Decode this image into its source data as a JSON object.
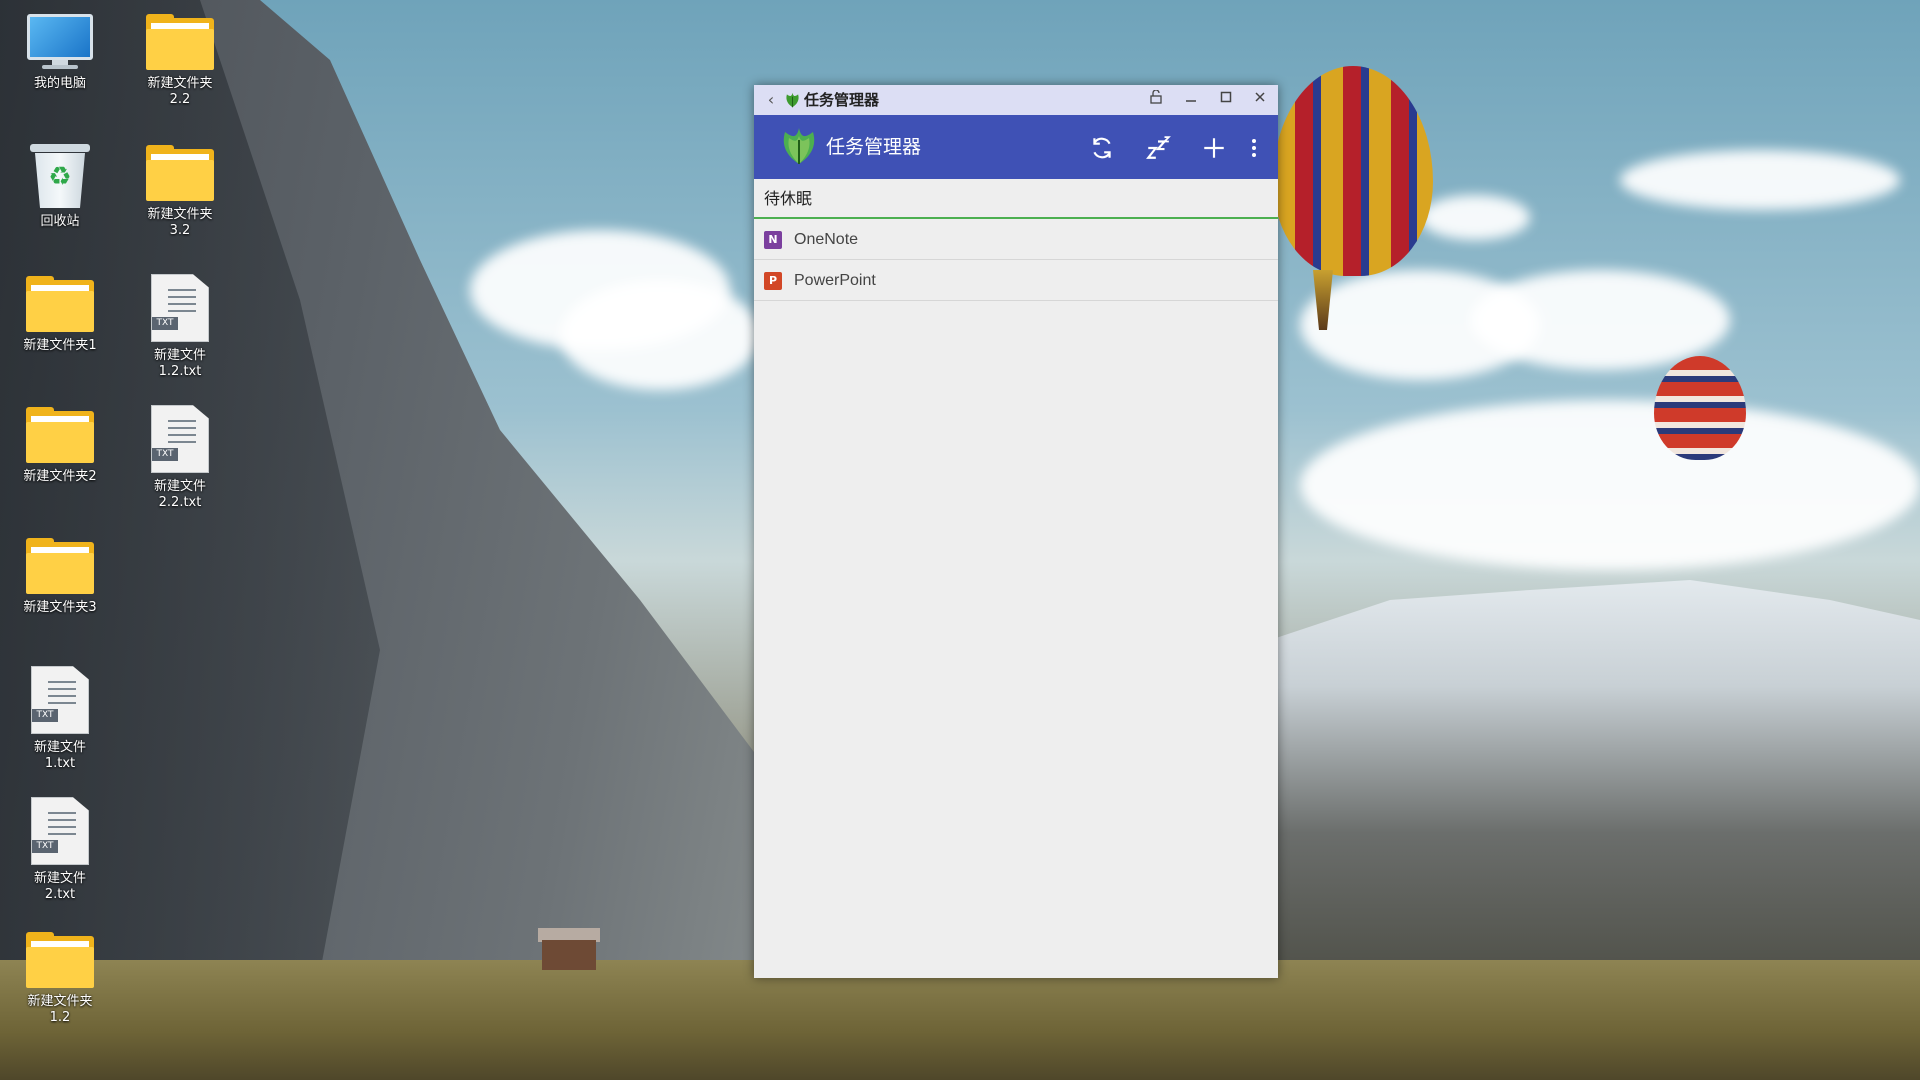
{
  "desktop": {
    "icons": [
      {
        "label": "我的电脑",
        "icon": "computer-icon"
      },
      {
        "label": "回收站",
        "icon": "recycle-bin-icon"
      },
      {
        "label": "新建文件夹1",
        "icon": "folder-icon"
      },
      {
        "label": "新建文件夹2",
        "icon": "folder-icon"
      },
      {
        "label": "新建文件夹3",
        "icon": "folder-icon"
      },
      {
        "label": "新建文件\n1.txt",
        "icon": "txt-file-icon"
      },
      {
        "label": "新建文件\n2.txt",
        "icon": "txt-file-icon"
      },
      {
        "label": "新建文件夹\n1.2",
        "icon": "folder-icon"
      },
      {
        "label": "新建文件夹\n2.2",
        "icon": "folder-icon"
      },
      {
        "label": "新建文件夹\n3.2",
        "icon": "folder-icon"
      },
      {
        "label": "新建文件\n1.2.txt",
        "icon": "txt-file-icon"
      },
      {
        "label": "新建文件\n2.2.txt",
        "icon": "txt-file-icon"
      }
    ],
    "txt_badge": "TXT"
  },
  "window": {
    "title": "任务管理器",
    "titlebar_buttons": [
      "back-icon",
      "pin-icon",
      "minimize-icon",
      "maximize-icon",
      "close-icon"
    ],
    "toolbar": {
      "title": "任务管理器",
      "actions": [
        "refresh-icon",
        "sleep-icon",
        "add-icon",
        "more-vert-icon"
      ],
      "color": "#3f51b5"
    },
    "section": {
      "title": "待休眠",
      "underline_color": "#4caf50"
    },
    "apps": [
      {
        "name": "OneNote",
        "icon": "onenote-icon",
        "icon_letter": "N",
        "color": "#7b3f9e"
      },
      {
        "name": "PowerPoint",
        "icon": "powerpoint-icon",
        "icon_letter": "P",
        "color": "#d24726"
      }
    ]
  }
}
